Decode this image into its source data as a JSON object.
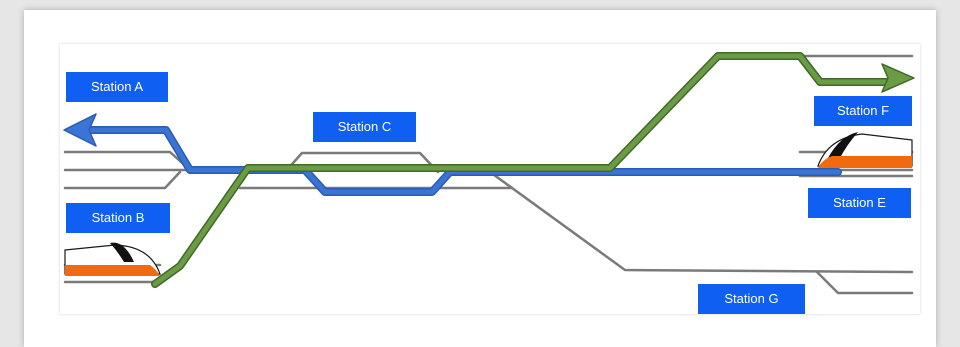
{
  "colors": {
    "track": "#7a7a7a",
    "blue_route": "#3a75d6",
    "green_route": "#5a8a3c",
    "station_label_bg": "#0e5ff2",
    "train_orange": "#f26a10",
    "train_black": "#111111"
  },
  "stations": {
    "a": "Station A",
    "b": "Station B",
    "c": "Station C",
    "e": "Station E",
    "f": "Station F",
    "g": "Station G"
  },
  "trains": {
    "left_icon": "high-speed-train-icon",
    "right_icon": "high-speed-train-icon"
  }
}
